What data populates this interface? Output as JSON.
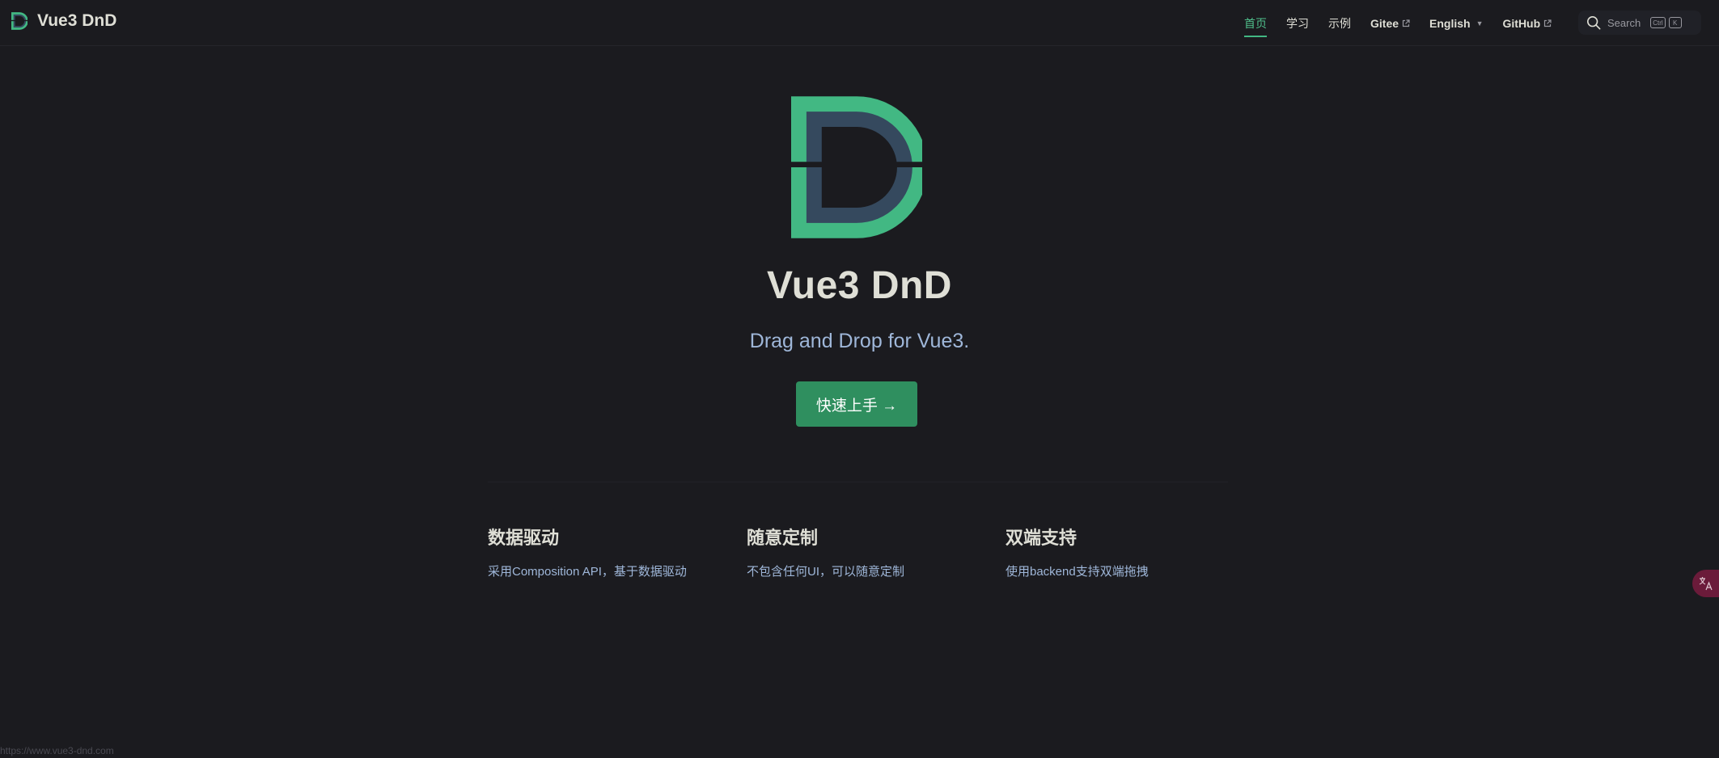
{
  "navbar": {
    "brand_title": "Vue3 DnD",
    "links": [
      {
        "label": "首页",
        "active": true,
        "external": false
      },
      {
        "label": "学习",
        "active": false,
        "external": false
      },
      {
        "label": "示例",
        "active": false,
        "external": false
      },
      {
        "label": "Gitee",
        "active": false,
        "external": true
      },
      {
        "label": "English",
        "active": false,
        "external": false,
        "dropdown": true
      },
      {
        "label": "GitHub",
        "active": false,
        "external": true
      }
    ],
    "search": {
      "label": "Search",
      "kbd_ctrl": "Ctrl",
      "kbd_key": "K"
    }
  },
  "hero": {
    "title": "Vue3 DnD",
    "tagline": "Drag and Drop for Vue3.",
    "cta_label": "快速上手 →"
  },
  "features": [
    {
      "title": "数据驱动",
      "desc": "采用Composition API，基于数据驱动"
    },
    {
      "title": "随意定制",
      "desc": "不包含任何UI，可以随意定制"
    },
    {
      "title": "双端支持",
      "desc": "使用backend支持双端拖拽"
    }
  ],
  "status_bar": {
    "url": "https://www.vue3-dnd.com"
  },
  "colors": {
    "background": "#1b1b1f",
    "brand_green": "#42b883",
    "brand_dark": "#35495e",
    "button_green": "#2f8f5f"
  }
}
